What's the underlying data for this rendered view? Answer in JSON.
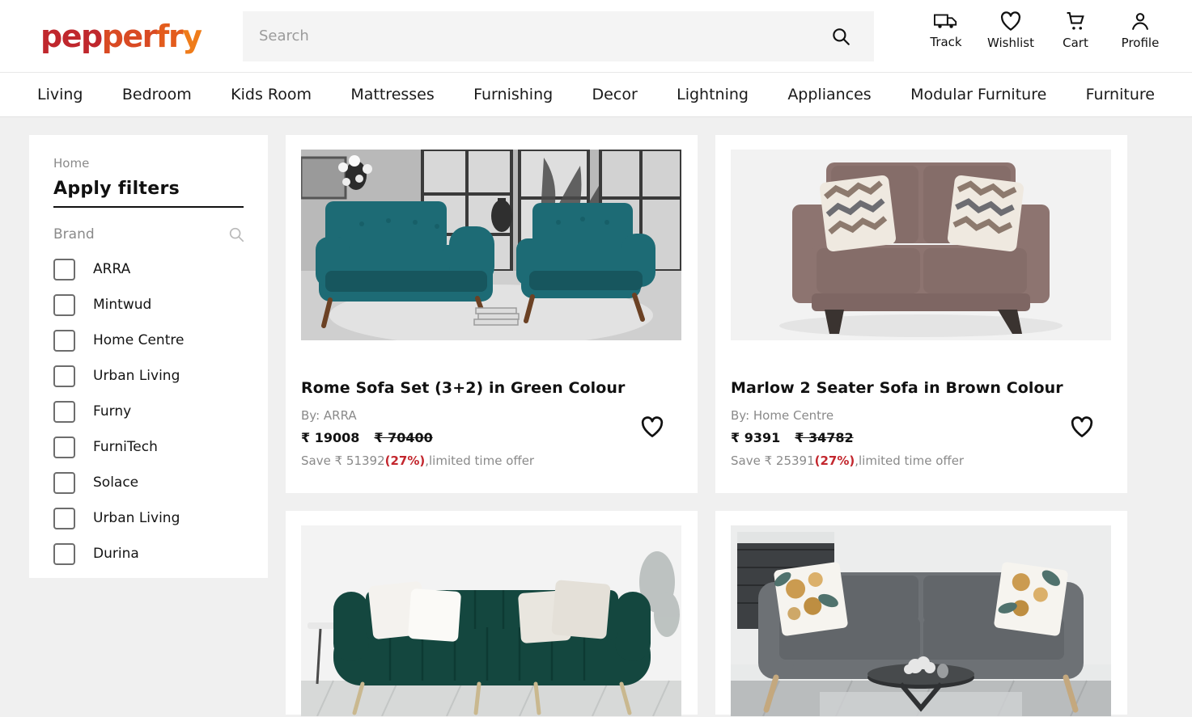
{
  "brand": {
    "name": "pepperfry",
    "color_start": "#c0272d",
    "color_end": "#ef7c1a",
    "parts": [
      "pep",
      "per",
      "f",
      "r",
      "y"
    ]
  },
  "search": {
    "placeholder": "Search",
    "value": "",
    "icon": "search-icon"
  },
  "header_actions": [
    {
      "label": "Track",
      "icon": "truck-icon"
    },
    {
      "label": "Wishlist",
      "icon": "heart-icon"
    },
    {
      "label": "Cart",
      "icon": "cart-icon"
    },
    {
      "label": "Profile",
      "icon": "person-icon"
    }
  ],
  "nav": {
    "items": [
      {
        "label": "Living"
      },
      {
        "label": "Bedroom"
      },
      {
        "label": "Kids Room"
      },
      {
        "label": "Mattresses"
      },
      {
        "label": "Furnishing"
      },
      {
        "label": "Decor"
      },
      {
        "label": "Lightning"
      },
      {
        "label": "Appliances"
      },
      {
        "label": "Modular Furniture"
      },
      {
        "label": "Furniture"
      }
    ]
  },
  "sidebar": {
    "breadcrumb": "Home",
    "title": "Apply filters",
    "brand_section": {
      "label": "Brand",
      "search_icon": "search-icon",
      "options": [
        {
          "label": "ARRA",
          "checked": false
        },
        {
          "label": "Mintwud",
          "checked": false
        },
        {
          "label": "Home Centre",
          "checked": false
        },
        {
          "label": "Urban Living",
          "checked": false
        },
        {
          "label": "Furny",
          "checked": false
        },
        {
          "label": "FurniTech",
          "checked": false
        },
        {
          "label": "Solace",
          "checked": false
        },
        {
          "label": "Urban Living",
          "checked": false
        },
        {
          "label": "Durina",
          "checked": false
        }
      ]
    }
  },
  "products": [
    {
      "title": "Rome Sofa Set (3+2) in Green Colour",
      "brand_prefix": "By: ",
      "brand": "ARRA",
      "price": "₹ 19008",
      "strike_price": "₹ 70400",
      "save_prefix": "Save ₹ 51392",
      "save_pct": "(27%)",
      "save_suffix": ",limited time offer",
      "wishlist_icon": "heart-icon",
      "image_alt": "teal sofa set in grayscale living room"
    },
    {
      "title": "Marlow 2 Seater Sofa in Brown Colour",
      "brand_prefix": "By: ",
      "brand": "Home Centre",
      "price": "₹ 9391",
      "strike_price": "₹ 34782",
      "save_prefix": "Save ₹ 25391",
      "save_pct": "(27%)",
      "save_suffix": ",limited time offer",
      "wishlist_icon": "heart-icon",
      "image_alt": "brown two seater sofa with chevron pillows"
    },
    {
      "image_alt": "dark green channel tufted sofa with white pillows"
    },
    {
      "image_alt": "grey fabric sofa with floral pillows and round table"
    }
  ],
  "colors": {
    "page_bg": "#f0f0f0",
    "card_bg": "#ffffff",
    "accent_red": "#c3272e",
    "muted_text": "#8a8a8a",
    "search_bg": "#f4f4f4"
  }
}
